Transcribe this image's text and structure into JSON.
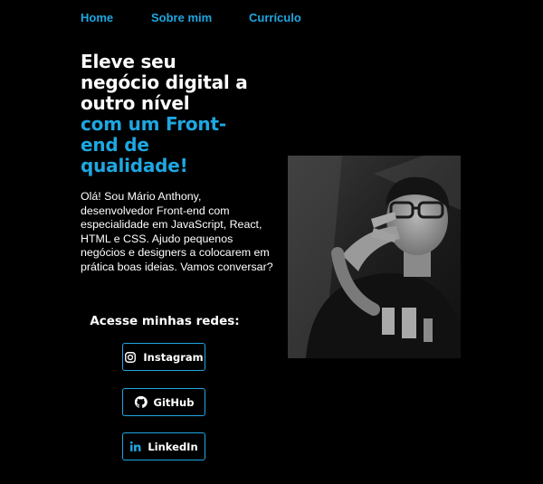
{
  "nav": {
    "items": [
      {
        "label": "Home"
      },
      {
        "label": "Sobre mim"
      },
      {
        "label": "Currículo"
      }
    ]
  },
  "hero": {
    "title_white": "Eleve seu negócio digital a outro nível",
    "title_blue": "com um Front-end de qualidade!",
    "intro": "Olá! Sou Mário Anthony, desenvolvedor Front-end com especialidade em JavaScript, React, HTML e CSS. Ajudo pequenos negócios e designers a colocarem em prática boas ideias. Vamos conversar?"
  },
  "social": {
    "heading": "Acesse minhas redes:",
    "buttons": [
      {
        "label": "Instagram",
        "icon": "instagram-icon"
      },
      {
        "label": "GitHub",
        "icon": "github-icon"
      },
      {
        "label": "LinkedIn",
        "icon": "linkedin-icon"
      }
    ]
  },
  "colors": {
    "background": "#000000",
    "accent": "#1ea7e1",
    "text": "#ffffff"
  }
}
